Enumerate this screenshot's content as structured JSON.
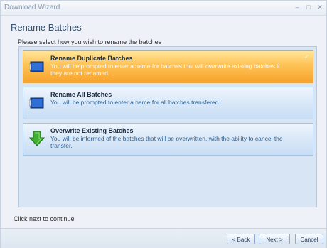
{
  "window": {
    "title": "Download Wizard",
    "controls": [
      "–",
      "□",
      "✕"
    ]
  },
  "header": {
    "title": "Rename Batches"
  },
  "instruction": "Please select how you wish to rename the batches",
  "options": [
    {
      "title": "Rename Duplicate Batches",
      "description": "You will be prompted to enter a name for batches that will overwrite existing batches if they are not renamed.",
      "icon": "batch-icon",
      "selected": true,
      "check": "✓"
    },
    {
      "title": "Rename All Batches",
      "description": "You will be prompted to enter a name for all batches transfered.",
      "icon": "batch-icon",
      "selected": false
    },
    {
      "title": "Overwrite Existing Batches",
      "description": "You will be informed of the batches that will be overwritten, with the ability to cancel the transfer.",
      "icon": "download-arrow-icon",
      "selected": false
    }
  ],
  "footer": {
    "text": "Click next to continue"
  },
  "buttons": {
    "back": "< Back",
    "next": "Next >",
    "cancel": "Cancel"
  },
  "colors": {
    "selected_option": "#f7a32b",
    "option_bg": "#dbe9f8",
    "title_color": "#36506f",
    "arrow_green": "#3fae2f"
  }
}
